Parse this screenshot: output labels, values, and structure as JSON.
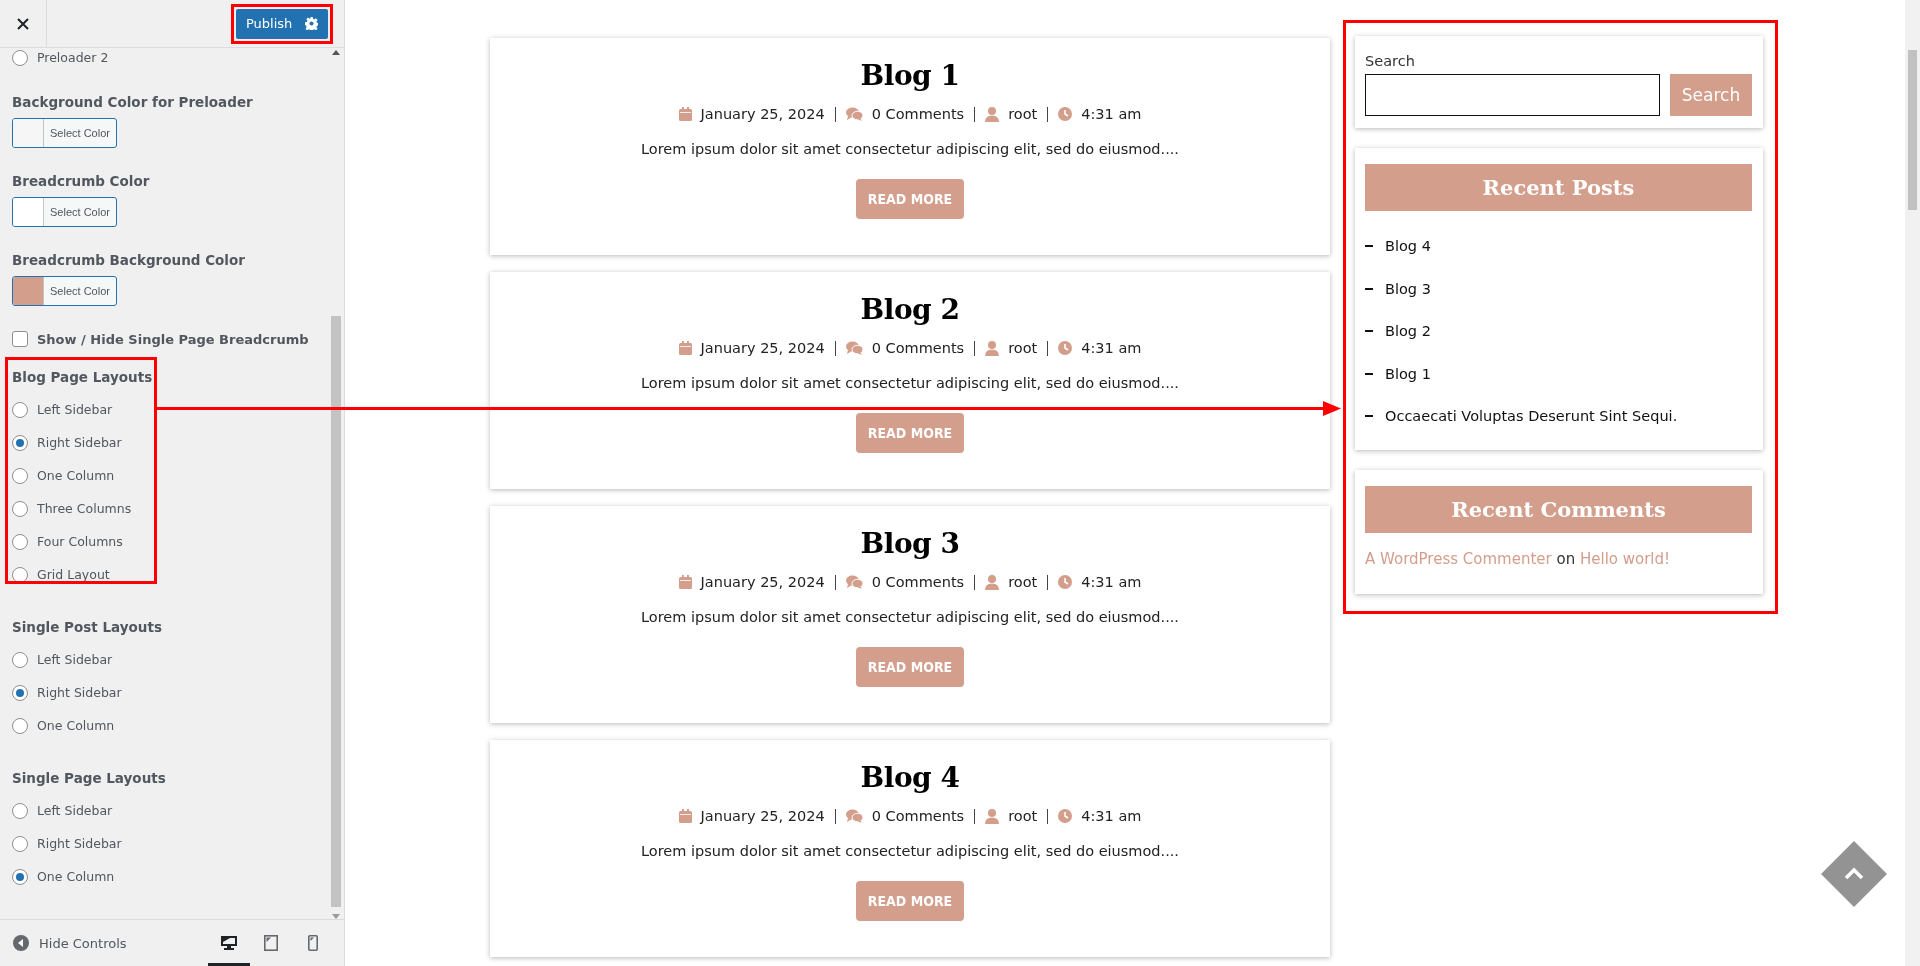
{
  "panel": {
    "publish": "Publish",
    "publish_highlighted": true,
    "controls": [
      {
        "kind": "radios",
        "options": [
          {
            "label": "Preloader 2",
            "selected": false
          }
        ]
      },
      {
        "kind": "color",
        "title": "Background Color for Preloader",
        "button": "Select Color",
        "color": "#f6f6f6"
      },
      {
        "kind": "color",
        "title": "Breadcrumb Color",
        "button": "Select Color",
        "color": "#ffffff"
      },
      {
        "kind": "color",
        "title": "Breadcrumb Background Color",
        "button": "Select Color",
        "color": "#d39e8b"
      },
      {
        "kind": "checkbox",
        "label": "Show / Hide Single Page Breadcrumb",
        "checked": false
      },
      {
        "kind": "radios",
        "title": "Blog Page Layouts",
        "highlighted": true,
        "options": [
          {
            "label": "Left Sidebar",
            "selected": false
          },
          {
            "label": "Right Sidebar",
            "selected": true
          },
          {
            "label": "One Column",
            "selected": false
          },
          {
            "label": "Three Columns",
            "selected": false
          },
          {
            "label": "Four Columns",
            "selected": false
          },
          {
            "label": "Grid Layout",
            "selected": false
          }
        ]
      },
      {
        "kind": "radios",
        "title": "Single Post Layouts",
        "options": [
          {
            "label": "Left Sidebar",
            "selected": false
          },
          {
            "label": "Right Sidebar",
            "selected": true
          },
          {
            "label": "One Column",
            "selected": false
          }
        ]
      },
      {
        "kind": "radios",
        "title": "Single Page Layouts",
        "options": [
          {
            "label": "Left Sidebar",
            "selected": false
          },
          {
            "label": "Right Sidebar",
            "selected": false
          },
          {
            "label": "One Column",
            "selected": true
          }
        ]
      }
    ],
    "hide_controls": "Hide Controls",
    "devices": [
      {
        "kind": "desktop",
        "selected": true
      },
      {
        "kind": "tablet",
        "selected": false
      },
      {
        "kind": "mobile",
        "selected": false
      }
    ]
  },
  "posts": [
    {
      "title": "Blog 1",
      "meta": [
        {
          "kind": "date",
          "text": "January 25, 2024"
        },
        {
          "kind": "comments",
          "text": "0 Comments"
        },
        {
          "kind": "author",
          "text": "root"
        },
        {
          "kind": "time",
          "text": "4:31 am"
        }
      ],
      "excerpt": "Lorem ipsum dolor sit amet consectetur adipiscing elit, sed do eiusmod....",
      "button": "READ MORE"
    },
    {
      "title": "Blog 2",
      "meta": [
        {
          "kind": "date",
          "text": "January 25, 2024"
        },
        {
          "kind": "comments",
          "text": "0 Comments"
        },
        {
          "kind": "author",
          "text": "root"
        },
        {
          "kind": "time",
          "text": "4:31 am"
        }
      ],
      "excerpt": "Lorem ipsum dolor sit amet consectetur adipiscing elit, sed do eiusmod....",
      "button": "READ MORE"
    },
    {
      "title": "Blog 3",
      "meta": [
        {
          "kind": "date",
          "text": "January 25, 2024"
        },
        {
          "kind": "comments",
          "text": "0 Comments"
        },
        {
          "kind": "author",
          "text": "root"
        },
        {
          "kind": "time",
          "text": "4:31 am"
        }
      ],
      "excerpt": "Lorem ipsum dolor sit amet consectetur adipiscing elit, sed do eiusmod....",
      "button": "READ MORE"
    },
    {
      "title": "Blog 4",
      "meta": [
        {
          "kind": "date",
          "text": "January 25, 2024"
        },
        {
          "kind": "comments",
          "text": "0 Comments"
        },
        {
          "kind": "author",
          "text": "root"
        },
        {
          "kind": "time",
          "text": "4:31 am"
        }
      ],
      "excerpt": "Lorem ipsum dolor sit amet consectetur adipiscing elit, sed do eiusmod....",
      "button": "READ MORE"
    }
  ],
  "sidebar": {
    "highlighted": true,
    "search": {
      "label": "Search",
      "button": "Search"
    },
    "recent_posts": {
      "title": "Recent Posts",
      "items": [
        "Blog 4",
        "Blog 3",
        "Blog 2",
        "Blog 1",
        "Occaecati Voluptas Deserunt Sint Sequi."
      ]
    },
    "recent_comments": {
      "title": "Recent Comments",
      "author": "A WordPress Commenter",
      "on": "on",
      "post": "Hello world!"
    }
  },
  "arrow": true
}
